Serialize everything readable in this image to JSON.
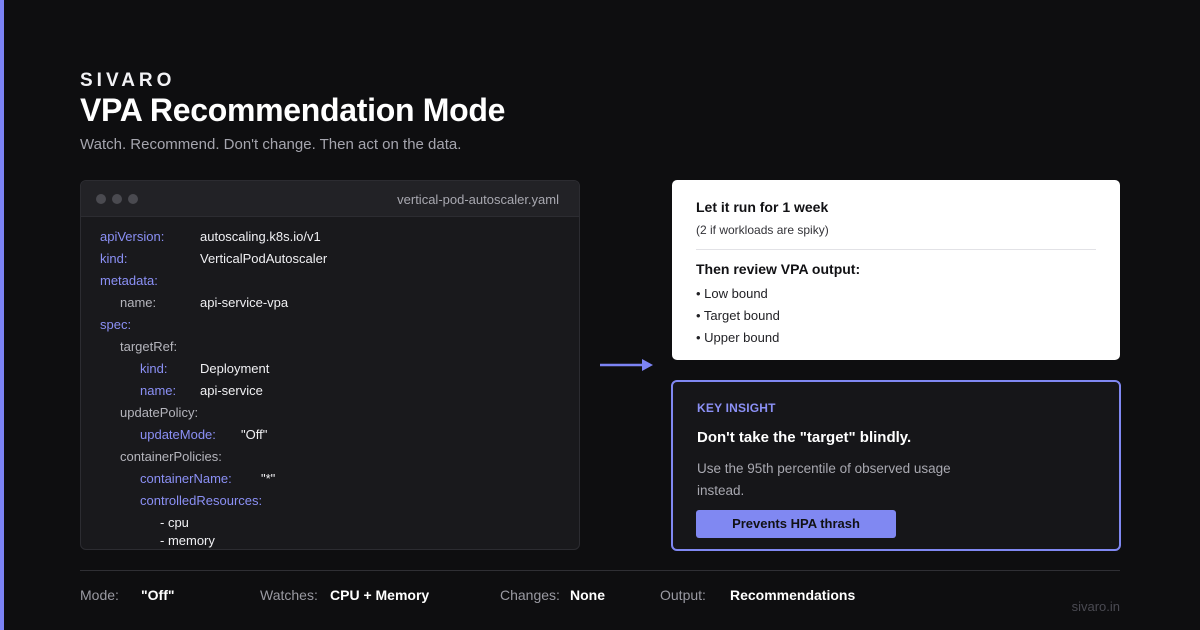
{
  "brand": "SIVARO",
  "title": "VPA Recommendation Mode",
  "subtitle": "Watch. Recommend. Don't change. Then act on the data.",
  "code_panel": {
    "filename": "vertical-pod-autoscaler.yaml",
    "lines": [
      {
        "key": "apiVersion:",
        "value": "autoscaling.k8s.io/v1"
      },
      {
        "key": "kind:",
        "value": "VerticalPodAutoscaler"
      },
      {
        "key": "metadata:",
        "value": ""
      },
      {
        "key": "name:",
        "value": "api-service-vpa"
      },
      {
        "key": "spec:",
        "value": ""
      },
      {
        "key": "targetRef:",
        "value": ""
      },
      {
        "key": "kind:",
        "value": "Deployment"
      },
      {
        "key": "name:",
        "value": "api-service"
      },
      {
        "key": "updatePolicy:",
        "value": ""
      },
      {
        "key": "updateMode:",
        "value": "\"Off\""
      },
      {
        "key": "containerPolicies:",
        "value": ""
      },
      {
        "key": "containerName:",
        "value": "\"*\""
      },
      {
        "key": "controlledResources:",
        "value": ""
      },
      {
        "key": "- cpu",
        "value": ""
      },
      {
        "key": "- memory",
        "value": ""
      }
    ]
  },
  "info_card": {
    "heading1": "Let it run for 1 week",
    "sub1": "(2 if workloads are spiky)",
    "heading2": "Then review VPA output:",
    "bullets": [
      "• Low bound",
      "• Target bound",
      "• Upper bound"
    ]
  },
  "insight": {
    "label": "KEY INSIGHT",
    "heading": "Don't take the \"target\" blindly.",
    "body": "Use the 95th percentile of observed usage instead.",
    "button": "Prevents HPA thrash"
  },
  "footer": {
    "items": [
      {
        "label": "Mode:",
        "value": "\"Off\""
      },
      {
        "label": "Watches:",
        "value": "CPU + Memory"
      },
      {
        "label": "Changes:",
        "value": "None"
      },
      {
        "label": "Output:",
        "value": "Recommendations"
      }
    ],
    "domain": "sivaro.in"
  },
  "colors": {
    "accent": "#8088f2",
    "background": "#0e0e10",
    "card": "#ffffff"
  }
}
